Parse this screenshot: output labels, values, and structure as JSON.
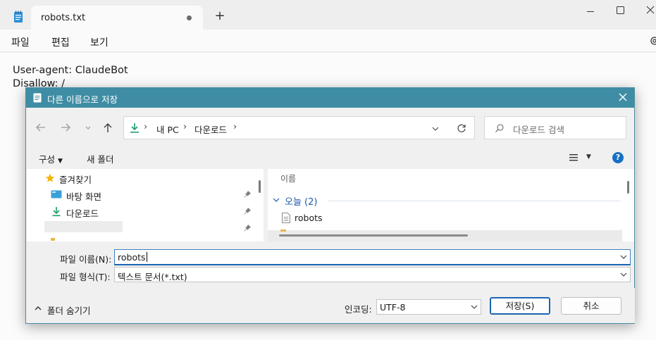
{
  "notepad": {
    "tab_title": "robots.txt",
    "new_tab_symbol": "+",
    "menu": [
      "파일",
      "편집",
      "보기"
    ],
    "lines": [
      "User-agent: ClaudeBot",
      "Disallow: /"
    ],
    "icons": [
      "notepad-icon",
      "minimize-icon",
      "maximize-icon",
      "close-icon",
      "settings-gear-icon"
    ]
  },
  "dialog": {
    "title": "다른 이름으로 저장",
    "breadcrumb": [
      "내 PC",
      "다운로드"
    ],
    "search_placeholder": "다운로드 검색",
    "toolbar": {
      "organize": "구성",
      "new_folder": "새 폴더",
      "help": "?"
    },
    "nav_pane": {
      "favorites": "즐겨찾기",
      "items": [
        {
          "label": "바탕 화면",
          "icon": "desktop-icon"
        },
        {
          "label": "다운로드",
          "icon": "download-icon"
        }
      ]
    },
    "file_list": {
      "column_name": "이름",
      "group": "오늘 (2)",
      "files": [
        {
          "name": "robots",
          "icon": "text-file-icon"
        }
      ]
    },
    "filename_label": "파일 이름(N):",
    "filename_value": "robots",
    "filetype_label": "파일 형식(T):",
    "filetype_value": "텍스트 문서(*.txt)",
    "hide_folders": "폴더 숨기기",
    "encoding_label": "인코딩:",
    "encoding_value": "UTF-8",
    "save_button": "저장(S)",
    "cancel_button": "취소"
  },
  "colors": {
    "dialog_title_bar": "#3f8da4",
    "accent_blue": "#1b64b3",
    "group_header": "#1e5aa8"
  }
}
